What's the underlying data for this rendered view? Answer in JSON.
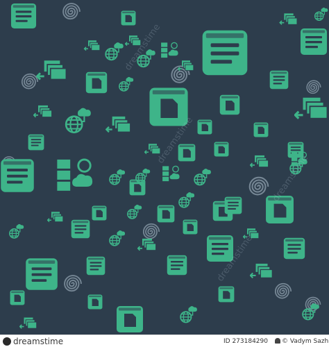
{
  "image": {
    "background_color": "#2d3d4c",
    "icon_color": "#3eb489",
    "icon_inner_color": "#2d3d4c",
    "swirl_color": "#8fa0ad",
    "watermark_text": "dreamstime",
    "icons_depicted": [
      "browser-window-icon",
      "document-icon",
      "file-stack-icon",
      "globe-network-icon",
      "cloud-database-icon",
      "arrow-icon"
    ]
  },
  "credit": {
    "brand": "dreamstime",
    "image_id": "ID 273184290",
    "author": "© Vadym Sazhniev"
  }
}
